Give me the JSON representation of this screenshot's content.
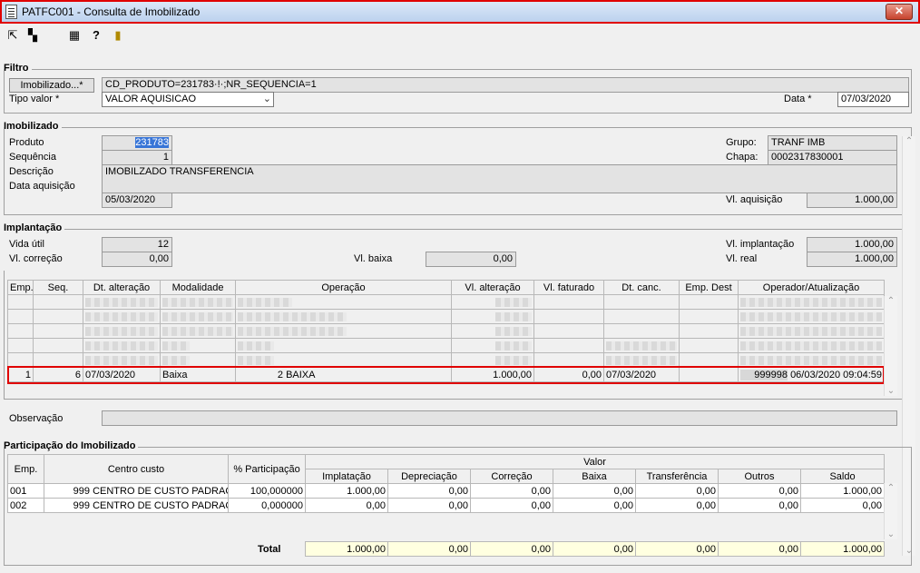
{
  "window": {
    "title": "PATFC001 - Consulta de Imobilizado",
    "close_label": "✕"
  },
  "filtro": {
    "title": "Filtro",
    "imob_button": "Imobilizado...*",
    "imob_value": "CD_PRODUTO=231783·!·;NR_SEQUENCIA=1",
    "tipo_label": "Tipo valor *",
    "tipo_value": "VALOR AQUISICAO",
    "data_label": "Data *",
    "data_value": "07/03/2020"
  },
  "imobilizado": {
    "title": "Imobilizado",
    "produto_label": "Produto",
    "produto_value": "231783",
    "seq_label": "Sequência",
    "seq_value": "1",
    "desc_label": "Descrição",
    "desc_value": "IMOBILZADO TRANSFERENCIA",
    "dataaq_label": "Data aquisição",
    "dataaq_value": "05/03/2020",
    "grupo_label": "Grupo:",
    "grupo_value": "TRANF IMB",
    "chapa_label": "Chapa:",
    "chapa_value": "0002317830001",
    "vlaq_label": "Vl. aquisição",
    "vlaq_value": "1.000,00"
  },
  "implantacao": {
    "title": "Implantação",
    "vida_label": "Vida útil",
    "vida_value": "12",
    "vlcorr_label": "Vl. correção",
    "vlcorr_value": "0,00",
    "vlbaixa_label": "Vl. baixa",
    "vlbaixa_value": "0,00",
    "vlimpl_label": "Vl. implantação",
    "vlimpl_value": "1.000,00",
    "vlreal_label": "Vl. real",
    "vlreal_value": "1.000,00"
  },
  "movimentos": {
    "headers": [
      "Emp.",
      "Seq.",
      "Dt. alteração",
      "Modalidade",
      "Operação",
      "Vl. alteração",
      "Vl. faturado",
      "Dt. canc.",
      "Emp. Dest",
      "Operador/Atualização"
    ],
    "selected_row": [
      "1",
      "6",
      "07/03/2020",
      "Baixa",
      "2",
      "BAIXA",
      "1.000,00",
      "0,00",
      "07/03/2020",
      "",
      "999998",
      "06/03/2020 09:04:59"
    ]
  },
  "observacao": {
    "label": "Observação",
    "value": ""
  },
  "participacao": {
    "title": "Participação do Imobilizado",
    "headers": {
      "emp": "Emp.",
      "centro": "Centro custo",
      "perc": "% Participação",
      "valor": "Valor",
      "sub": [
        "Implatação",
        "Depreciação",
        "Correção",
        "Baixa",
        "Transferência",
        "Outros",
        "Saldo"
      ]
    },
    "rows": [
      {
        "emp": "001",
        "cc_code": "999",
        "cc_name": "CENTRO DE CUSTO PADRAO",
        "perc": "100,000000",
        "vals": [
          "1.000,00",
          "0,00",
          "0,00",
          "0,00",
          "0,00",
          "0,00",
          "1.000,00"
        ]
      },
      {
        "emp": "002",
        "cc_code": "999",
        "cc_name": "CENTRO DE CUSTO PADRAO",
        "perc": "0,000000",
        "vals": [
          "0,00",
          "0,00",
          "0,00",
          "0,00",
          "0,00",
          "0,00",
          "0,00"
        ]
      }
    ],
    "total_label": "Total",
    "totals": [
      "1.000,00",
      "0,00",
      "0,00",
      "0,00",
      "0,00",
      "0,00",
      "1.000,00"
    ]
  },
  "icons": [
    "exit-icon",
    "windows-icon",
    "calculator-icon",
    "help-icon",
    "door-icon"
  ]
}
